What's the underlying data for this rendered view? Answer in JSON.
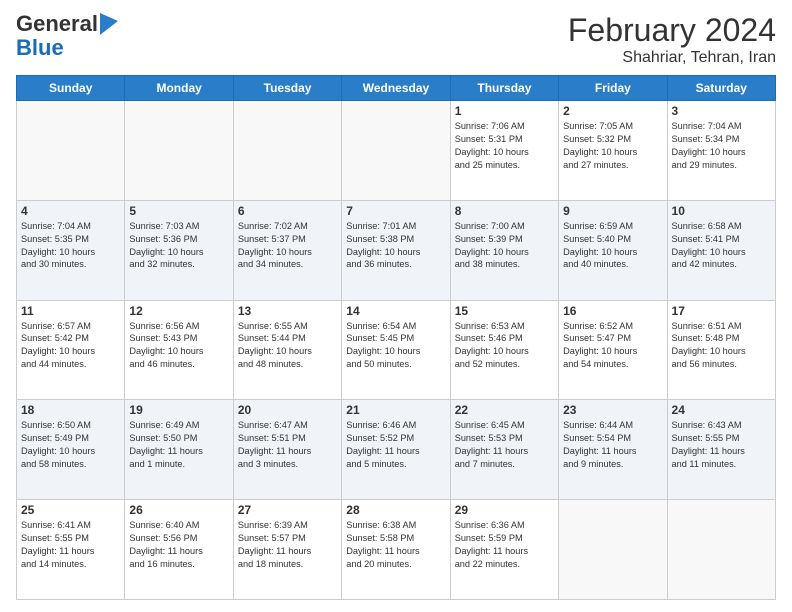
{
  "header": {
    "logo_line1": "General",
    "logo_line2": "Blue",
    "month_year": "February 2024",
    "location": "Shahriar, Tehran, Iran"
  },
  "weekdays": [
    "Sunday",
    "Monday",
    "Tuesday",
    "Wednesday",
    "Thursday",
    "Friday",
    "Saturday"
  ],
  "weeks": [
    [
      {
        "day": "",
        "info": "",
        "empty": true
      },
      {
        "day": "",
        "info": "",
        "empty": true
      },
      {
        "day": "",
        "info": "",
        "empty": true
      },
      {
        "day": "",
        "info": "",
        "empty": true
      },
      {
        "day": "1",
        "info": "Sunrise: 7:06 AM\nSunset: 5:31 PM\nDaylight: 10 hours\nand 25 minutes."
      },
      {
        "day": "2",
        "info": "Sunrise: 7:05 AM\nSunset: 5:32 PM\nDaylight: 10 hours\nand 27 minutes."
      },
      {
        "day": "3",
        "info": "Sunrise: 7:04 AM\nSunset: 5:34 PM\nDaylight: 10 hours\nand 29 minutes."
      }
    ],
    [
      {
        "day": "4",
        "info": "Sunrise: 7:04 AM\nSunset: 5:35 PM\nDaylight: 10 hours\nand 30 minutes."
      },
      {
        "day": "5",
        "info": "Sunrise: 7:03 AM\nSunset: 5:36 PM\nDaylight: 10 hours\nand 32 minutes."
      },
      {
        "day": "6",
        "info": "Sunrise: 7:02 AM\nSunset: 5:37 PM\nDaylight: 10 hours\nand 34 minutes."
      },
      {
        "day": "7",
        "info": "Sunrise: 7:01 AM\nSunset: 5:38 PM\nDaylight: 10 hours\nand 36 minutes."
      },
      {
        "day": "8",
        "info": "Sunrise: 7:00 AM\nSunset: 5:39 PM\nDaylight: 10 hours\nand 38 minutes."
      },
      {
        "day": "9",
        "info": "Sunrise: 6:59 AM\nSunset: 5:40 PM\nDaylight: 10 hours\nand 40 minutes."
      },
      {
        "day": "10",
        "info": "Sunrise: 6:58 AM\nSunset: 5:41 PM\nDaylight: 10 hours\nand 42 minutes."
      }
    ],
    [
      {
        "day": "11",
        "info": "Sunrise: 6:57 AM\nSunset: 5:42 PM\nDaylight: 10 hours\nand 44 minutes."
      },
      {
        "day": "12",
        "info": "Sunrise: 6:56 AM\nSunset: 5:43 PM\nDaylight: 10 hours\nand 46 minutes."
      },
      {
        "day": "13",
        "info": "Sunrise: 6:55 AM\nSunset: 5:44 PM\nDaylight: 10 hours\nand 48 minutes."
      },
      {
        "day": "14",
        "info": "Sunrise: 6:54 AM\nSunset: 5:45 PM\nDaylight: 10 hours\nand 50 minutes."
      },
      {
        "day": "15",
        "info": "Sunrise: 6:53 AM\nSunset: 5:46 PM\nDaylight: 10 hours\nand 52 minutes."
      },
      {
        "day": "16",
        "info": "Sunrise: 6:52 AM\nSunset: 5:47 PM\nDaylight: 10 hours\nand 54 minutes."
      },
      {
        "day": "17",
        "info": "Sunrise: 6:51 AM\nSunset: 5:48 PM\nDaylight: 10 hours\nand 56 minutes."
      }
    ],
    [
      {
        "day": "18",
        "info": "Sunrise: 6:50 AM\nSunset: 5:49 PM\nDaylight: 10 hours\nand 58 minutes."
      },
      {
        "day": "19",
        "info": "Sunrise: 6:49 AM\nSunset: 5:50 PM\nDaylight: 11 hours\nand 1 minute."
      },
      {
        "day": "20",
        "info": "Sunrise: 6:47 AM\nSunset: 5:51 PM\nDaylight: 11 hours\nand 3 minutes."
      },
      {
        "day": "21",
        "info": "Sunrise: 6:46 AM\nSunset: 5:52 PM\nDaylight: 11 hours\nand 5 minutes."
      },
      {
        "day": "22",
        "info": "Sunrise: 6:45 AM\nSunset: 5:53 PM\nDaylight: 11 hours\nand 7 minutes."
      },
      {
        "day": "23",
        "info": "Sunrise: 6:44 AM\nSunset: 5:54 PM\nDaylight: 11 hours\nand 9 minutes."
      },
      {
        "day": "24",
        "info": "Sunrise: 6:43 AM\nSunset: 5:55 PM\nDaylight: 11 hours\nand 11 minutes."
      }
    ],
    [
      {
        "day": "25",
        "info": "Sunrise: 6:41 AM\nSunset: 5:55 PM\nDaylight: 11 hours\nand 14 minutes."
      },
      {
        "day": "26",
        "info": "Sunrise: 6:40 AM\nSunset: 5:56 PM\nDaylight: 11 hours\nand 16 minutes."
      },
      {
        "day": "27",
        "info": "Sunrise: 6:39 AM\nSunset: 5:57 PM\nDaylight: 11 hours\nand 18 minutes."
      },
      {
        "day": "28",
        "info": "Sunrise: 6:38 AM\nSunset: 5:58 PM\nDaylight: 11 hours\nand 20 minutes."
      },
      {
        "day": "29",
        "info": "Sunrise: 6:36 AM\nSunset: 5:59 PM\nDaylight: 11 hours\nand 22 minutes."
      },
      {
        "day": "",
        "info": "",
        "empty": true
      },
      {
        "day": "",
        "info": "",
        "empty": true
      }
    ]
  ]
}
